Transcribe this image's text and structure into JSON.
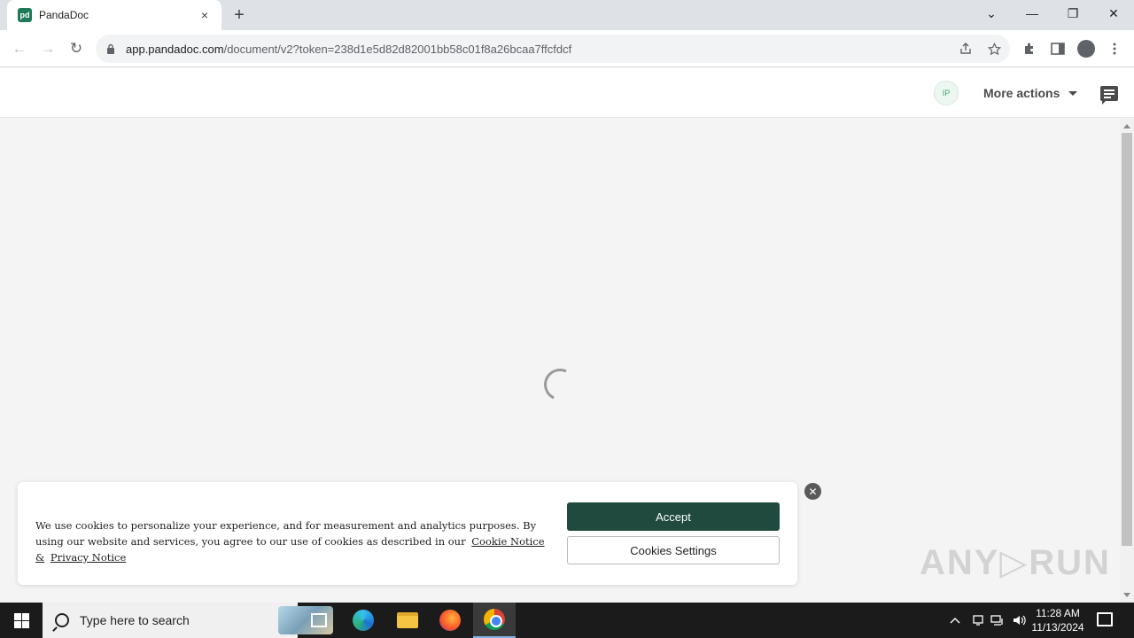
{
  "browser": {
    "tab": {
      "favicon_text": "pd",
      "title": "PandaDoc",
      "close": "×"
    },
    "new_tab": "+",
    "window_controls": {
      "dropdown": "⌄",
      "minimize": "—",
      "restore": "❐",
      "close": "✕"
    },
    "nav": {
      "back": "←",
      "forward": "→",
      "reload": "↻"
    },
    "url_host": "app.pandadoc.com",
    "url_path": "/document/v2?token=238d1e5d82d82001bb58c01f8a26bcaa7ffcfdcf"
  },
  "app_header": {
    "avatar_initials": "IP",
    "more_actions_label": "More actions"
  },
  "cookie_banner": {
    "text": "We use cookies to personalize your experience, and for measurement and analytics purposes. By using our website and services, you agree to our use of cookies as described in our",
    "cookie_notice_link": "Cookie Notice &",
    "privacy_notice_link": "Privacy Notice",
    "accept_label": "Accept",
    "settings_label": "Cookies Settings",
    "close": "✕"
  },
  "watermark": "ANY▷RUN",
  "taskbar": {
    "search_placeholder": "Type here to search",
    "time": "11:28 AM",
    "date": "11/13/2024"
  },
  "colors": {
    "accept_button": "#1f4a3d",
    "brand": "#1f7a5a"
  }
}
